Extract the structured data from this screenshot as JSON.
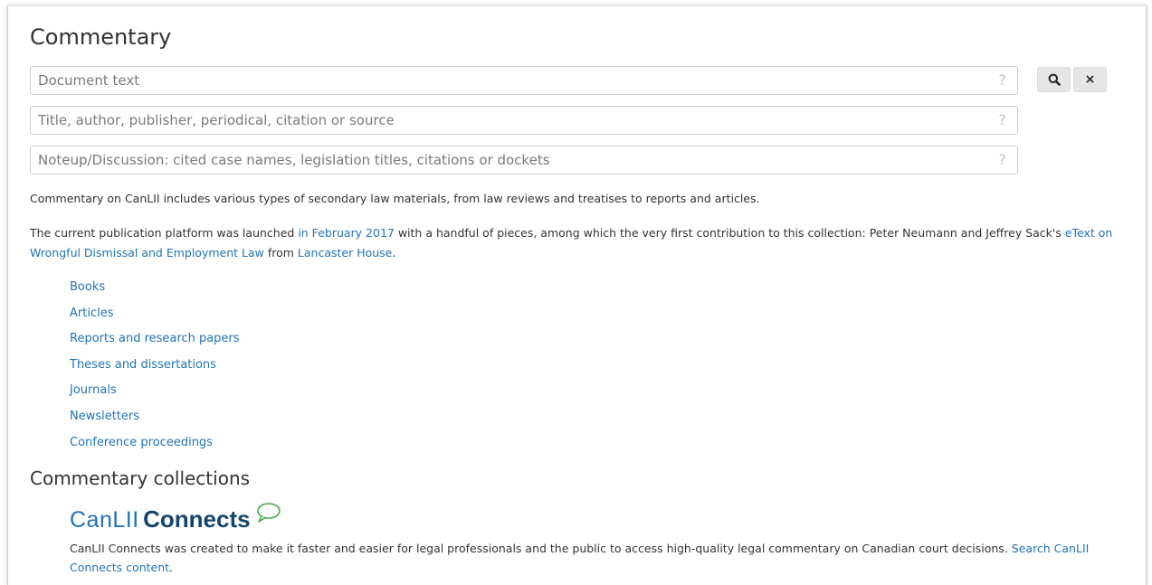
{
  "page": {
    "title": "Commentary"
  },
  "search": {
    "fields": [
      {
        "placeholder": "Document text",
        "value": ""
      },
      {
        "placeholder": "Title, author, publisher, periodical, citation or source",
        "value": ""
      },
      {
        "placeholder": "Noteup/Discussion: cited case names, legislation titles, citations or dockets",
        "value": ""
      }
    ],
    "help_glyph": "?",
    "search_button_icon": "search-icon",
    "clear_button_label": "×"
  },
  "intro": {
    "para1": "Commentary on CanLII includes various types of secondary law materials, from law reviews and treatises to reports and articles.",
    "para2_part1": "The current publication platform was launched ",
    "para2_link1": "in February 2017",
    "para2_part2": " with a handful of pieces, among which the very first contribution to this collection: Peter Neumann and Jeffrey Sack's ",
    "para2_link2": "eText on Wrongful Dismissal and Employment Law",
    "para2_part3": " from ",
    "para2_link3": "Lancaster House",
    "para2_part4": "."
  },
  "types": [
    "Books",
    "Articles",
    "Reports and research papers",
    "Theses and dissertations",
    "Journals",
    "Newsletters",
    "Conference proceedings"
  ],
  "collections": {
    "heading": "Commentary collections",
    "logo_part1": "CanLII",
    "logo_part2": "Connects",
    "description": "CanLII Connects was created to make it faster and easier for legal professionals and the public to access high-quality legal commentary on Canadian court decisions. ",
    "search_link": "Search CanLII Connects content",
    "description_end": "."
  },
  "colors": {
    "link": "#1f73b7",
    "logo_dark": "#14456b",
    "logo_bubble": "#3fae49"
  }
}
